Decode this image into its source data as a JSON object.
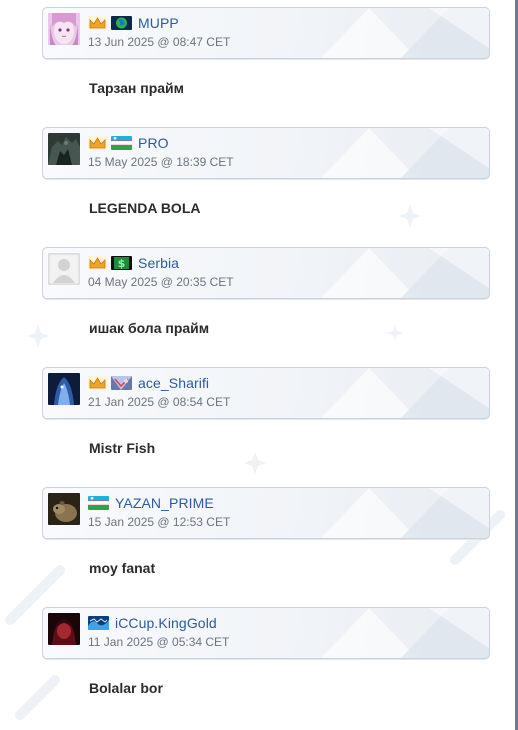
{
  "comments": [
    {
      "username": "MUPP",
      "date": "13 Jun 2025 @ 08:47 CET",
      "text": "Тарзан прайм",
      "avatar": "anime-girl",
      "badge": "crown-icon",
      "flag": "globe-flag"
    },
    {
      "username": "PRO",
      "date": "15 May 2025 @ 18:39 CET",
      "text": "LEGENDA BOLA",
      "avatar": "dark-figure",
      "badge": "crown-icon",
      "flag": "uzbekistan-flag"
    },
    {
      "username": "Serbia",
      "date": "04 May 2025 @ 20:35 CET",
      "text": "ишак бола прайм",
      "avatar": "default-avatar",
      "badge": "crown-icon",
      "flag": "dollar-flag"
    },
    {
      "username": "ace_Sharifi",
      "date": "21 Jan 2025 @ 08:54 CET",
      "text": "Mistr Fish",
      "avatar": "blue-creature",
      "badge": "crown-icon",
      "flag": "custom-flag"
    },
    {
      "username": "YAZAN_PRIME",
      "date": "15 Jan 2025 @ 12:53 CET",
      "text": "moy fanat",
      "avatar": "rodent",
      "badge": "",
      "flag": "uzbekistan-flag"
    },
    {
      "username": "iCCup.KingGold",
      "date": "11 Jan 2025 @ 05:34 CET",
      "text": "Bolalar bor",
      "avatar": "red-character",
      "badge": "",
      "flag": "iccup-flag"
    }
  ],
  "colors": {
    "username": "#2a5aa0",
    "date": "#6b7480",
    "header_border": "#c9d2dd",
    "body_text": "#2b2b2b"
  }
}
